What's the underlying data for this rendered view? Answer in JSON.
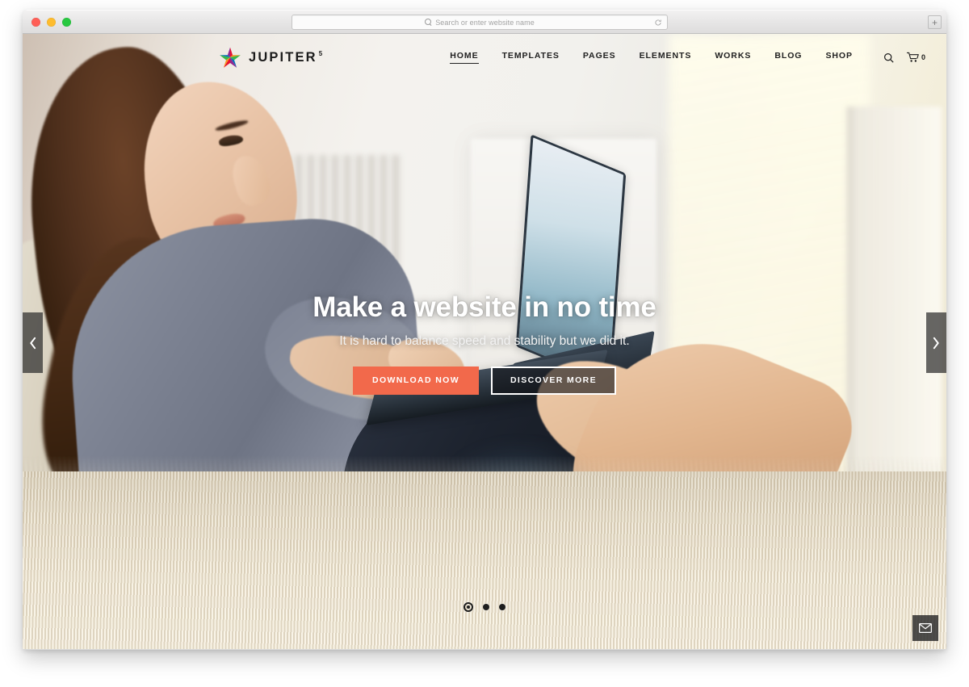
{
  "browser": {
    "traffic_lights": [
      "close",
      "minimize",
      "maximize"
    ],
    "address_placeholder": "Search or enter website name",
    "address_value": "",
    "reload_label": "Reload",
    "newtab_label": "+"
  },
  "site": {
    "logo": {
      "name": "JUPITER",
      "superscript": "5",
      "icon": "rainbow-star-icon"
    },
    "nav": [
      {
        "label": "HOME",
        "active": true
      },
      {
        "label": "TEMPLATES",
        "active": false
      },
      {
        "label": "PAGES",
        "active": false
      },
      {
        "label": "ELEMENTS",
        "active": false
      },
      {
        "label": "WORKS",
        "active": false
      },
      {
        "label": "BLOG",
        "active": false
      },
      {
        "label": "SHOP",
        "active": false
      }
    ],
    "nav_icons": {
      "search": "search-icon",
      "cart": "shopping-cart-icon",
      "cart_count": "0"
    },
    "hero": {
      "title": "Make a website in no time",
      "subtitle": "It is hard to balance speed and stability but we did it.",
      "primary_button": "DOWNLOAD NOW",
      "secondary_button": "DISCOVER MORE"
    },
    "slider": {
      "prev_icon": "chevron-left-icon",
      "next_icon": "chevron-right-icon",
      "dots": [
        {
          "active": true
        },
        {
          "active": false
        },
        {
          "active": false
        }
      ]
    },
    "contact_fab": {
      "icon": "envelope-icon"
    }
  },
  "colors": {
    "accent_orange": "#f2694b",
    "nav_text": "#212121",
    "hero_title": "#ffffff",
    "arrow_bg": "rgba(44,44,44,.72)",
    "star_red": "#e8112d",
    "star_orange": "#f7941e",
    "star_green": "#39b54a",
    "star_blue": "#0071bc",
    "star_purple": "#92278f"
  }
}
